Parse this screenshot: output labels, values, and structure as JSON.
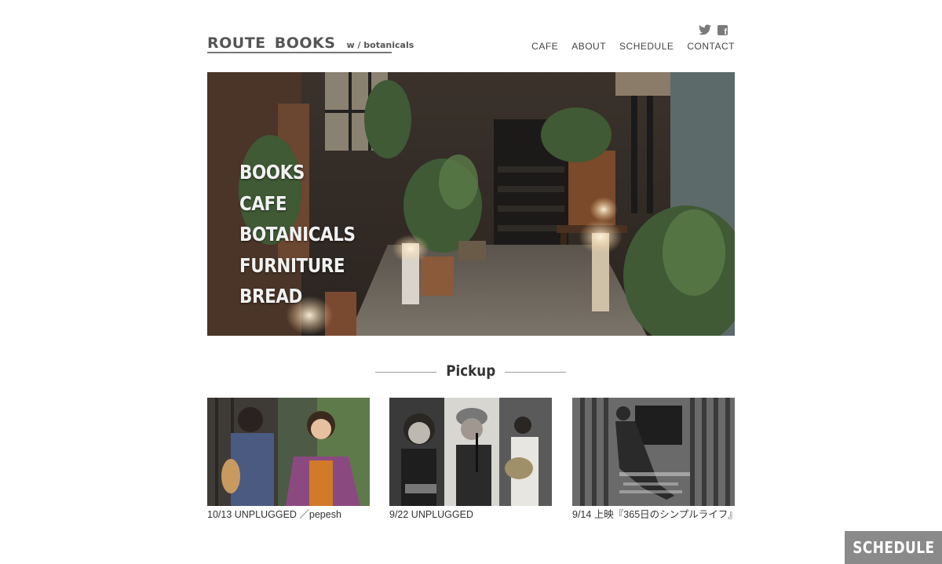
{
  "header": {
    "logo_main": "ROUTE BOOKS",
    "logo_sub": "w / botanicals",
    "social": [
      "twitter-icon",
      "facebook-icon"
    ]
  },
  "nav": {
    "items": [
      {
        "label": "CAFE"
      },
      {
        "label": "ABOUT"
      },
      {
        "label": "SCHEDULE"
      },
      {
        "label": "CONTACT"
      }
    ]
  },
  "hero": {
    "words": [
      "BOOKS",
      "CAFE",
      "BOTANICALS",
      "FURNITURE",
      "BREAD"
    ]
  },
  "pickup": {
    "title": "Pickup",
    "cards": [
      {
        "caption": "10/13 UNPLUGGED ／pepesh"
      },
      {
        "caption": "9/22 UNPLUGGED"
      },
      {
        "caption": "9/14 上映『365日のシンプルライフ』"
      }
    ]
  },
  "floating": {
    "schedule_label": "SCHEDULE"
  },
  "colors": {
    "text": "#333333",
    "button_bg": "#8a8a8a"
  }
}
